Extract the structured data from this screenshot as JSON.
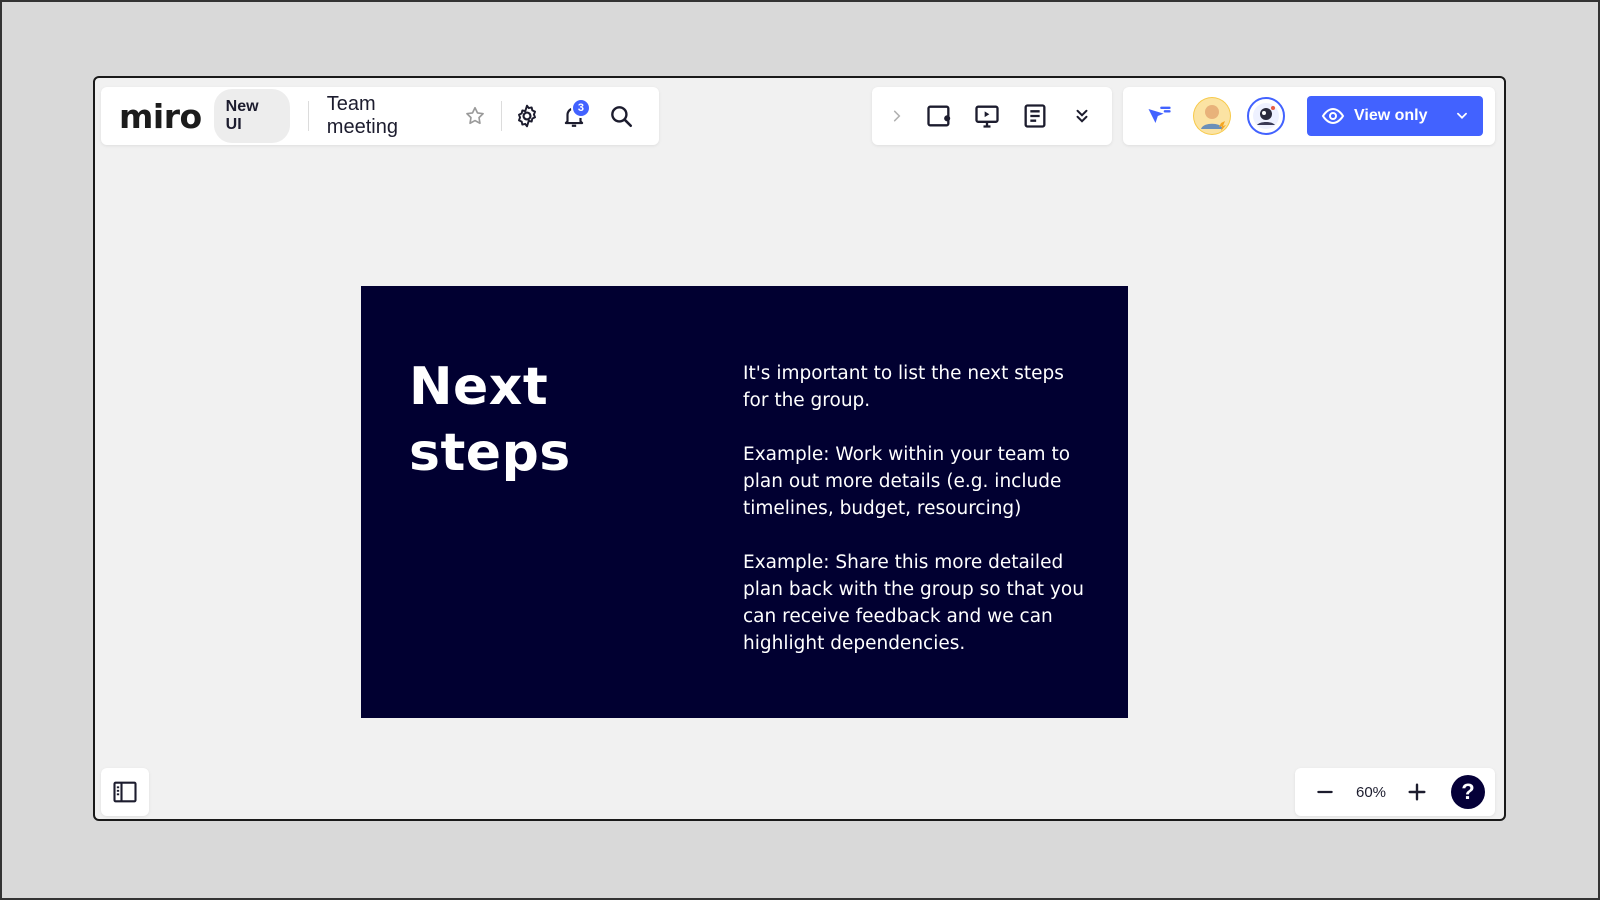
{
  "app": {
    "logo": "miro",
    "badge_label": "New UI"
  },
  "board": {
    "title": "Team meeting"
  },
  "notifications": {
    "count": "3"
  },
  "toolbar": {
    "view_mode_label": "View only"
  },
  "frame": {
    "title": "Next steps",
    "paragraphs": [
      "It's important to list the next steps for the group.",
      "Example: Work within your team to plan out more details (e.g. include timelines, budget, resourcing)",
      "Example: Share this more detailed plan back with the group so that you can receive feedback and we can highlight dependencies."
    ],
    "background": "#010031"
  },
  "zoom": {
    "level": "60%"
  },
  "help": {
    "label": "?"
  },
  "colors": {
    "accent": "#4262ff",
    "canvas": "#f1f1f1",
    "dark": "#050038"
  },
  "icons": [
    "star-icon",
    "gear-icon",
    "bell-icon",
    "search-icon",
    "chevron-right-icon",
    "sticky-note-icon",
    "presentation-icon",
    "document-icon",
    "double-chevron-down-icon",
    "cursor-filter-icon",
    "eye-icon",
    "chevron-down-icon",
    "sidebar-panel-icon",
    "minus-icon",
    "plus-icon"
  ]
}
